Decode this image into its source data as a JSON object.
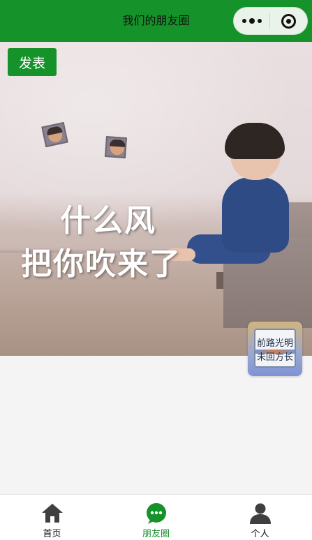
{
  "header": {
    "title": "我们的朋友圈",
    "more_icon": "more-dots-icon",
    "close_icon": "target-circle-icon"
  },
  "publish_button": {
    "label": "发表"
  },
  "post": {
    "meme_text_line1": "什么风",
    "meme_text_line2": "把你吹来了"
  },
  "floating_avatar": {
    "line1": "前路光明",
    "line2": "未回方长"
  },
  "tabbar": {
    "items": [
      {
        "label": "首页",
        "icon": "home-icon",
        "active": false
      },
      {
        "label": "朋友圈",
        "icon": "chat-bubble-icon",
        "active": true
      },
      {
        "label": "个人",
        "icon": "person-icon",
        "active": false
      }
    ]
  },
  "colors": {
    "primary": "#16922b",
    "background": "#f4f4f4",
    "tab_inactive_icon": "#3f3f3f"
  }
}
